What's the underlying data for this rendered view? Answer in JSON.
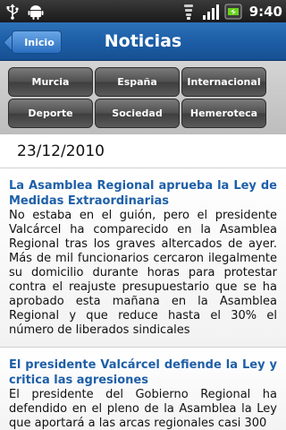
{
  "status_bar": {
    "time": "9:40",
    "icons": [
      "usb-icon",
      "android-icon",
      "wifi-icon",
      "signal-icon",
      "battery-icon"
    ]
  },
  "header": {
    "back_label": "Inicio",
    "title": "Noticias"
  },
  "categories": [
    {
      "label": "Murcia"
    },
    {
      "label": "España"
    },
    {
      "label": "Internacional"
    },
    {
      "label": "Deporte"
    },
    {
      "label": "Sociedad"
    },
    {
      "label": "Hemeroteca"
    }
  ],
  "date": "23/12/2010",
  "news": [
    {
      "title": "La Asamblea Regional aprueba la Ley de Medidas Extraordinarias",
      "body": "No estaba en el guión, pero el presidente Valcárcel ha comparecido en la Asamblea Regional tras los graves altercados de ayer. Más de mil funcionarios cercaron ilegalmente su domicilio durante horas para protestar contra el reajuste presupuestario que se ha aprobado esta mañana en la Asamblea Regional y que reduce hasta el 30% el número de liberados sindicales"
    },
    {
      "title": "El presidente Valcárcel defiende la Ley y critica las agresiones",
      "body": "El presidente del Gobierno Regional ha defendido en el pleno de la Asamblea la Ley que aportará a las arcas regionales casi 300"
    }
  ],
  "colors": {
    "header_blue": "#1d5ea6",
    "title_blue": "#1e5fa8"
  }
}
